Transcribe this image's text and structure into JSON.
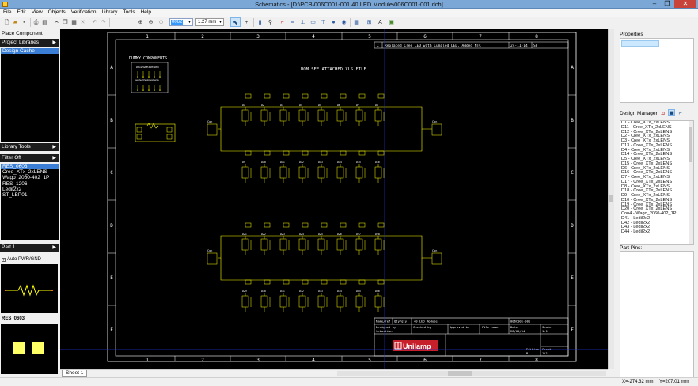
{
  "window": {
    "title": "Schematics - [D:\\PCB\\006C001-001 40 LED Module\\006C001-001.dch]",
    "min": "–",
    "max": "❐",
    "close": "✕"
  },
  "menu": [
    "File",
    "Edit",
    "View",
    "Objects",
    "Verification",
    "Library",
    "Tools",
    "Help"
  ],
  "toolbar": {
    "zoom_value": "0062",
    "grid_value": "1.27 mm"
  },
  "left_panel": {
    "place_component": "Place Component",
    "project_libraries": "Project Libraries",
    "design_cache": "Design Cache",
    "library_tools": "Library Tools",
    "filter": "Filter Off",
    "components": [
      "RES_0603",
      "Cree_XTx_2xLENS",
      "Wago_2060-402_1P",
      "RES_1206",
      "Ledil2x2",
      "ST_LBP01"
    ],
    "selected_component": "RES_0603",
    "part_selector": "Part 1",
    "auto_pwr_gnd": "Auto PWR/GND",
    "footprint_label": "RES_0603"
  },
  "sheet_tab": "Sheet 1",
  "schematic": {
    "col_labels": [
      "1",
      "2",
      "3",
      "4",
      "5",
      "6",
      "7",
      "8"
    ],
    "row_labels": [
      "A",
      "B",
      "C",
      "D",
      "E",
      "F"
    ],
    "dummy_title": "DUMMY COMPONENTS",
    "dummy_row1": "DH1DH2DH3DH4DH5",
    "dummy_row2": "DH6DH7DH8DH9DH10",
    "bom_note": "BOM SEE ATTACHED XLS FILE",
    "revision": {
      "rev": "C",
      "description": "Replaced Cree LED with Lumiled LED. Added NTC",
      "date": "24-11-14",
      "initials": "SF"
    },
    "title_block": {
      "name_label": "Name/ref",
      "qty_label": "Qty/qty",
      "module_name": "40 LED Module",
      "part_number": "006C001-001",
      "designed_by_label": "Designed by",
      "designed_by": "Sebastian",
      "checked_by_label": "Checked by",
      "approved_by_label": "Approved by",
      "file_name_label": "File name",
      "date_label": "Date",
      "date": "28/05/14",
      "scale_label": "Scale",
      "scale": "1:1",
      "edition_label": "Edition",
      "edition": "B",
      "sheet_label": "Sheet",
      "sheet": "1/1",
      "company": "Unilamp"
    },
    "top_string_top_leds": [
      "D1",
      "D2",
      "D3",
      "D4",
      "D5",
      "D6",
      "D7",
      "D8"
    ],
    "top_string_bottom_leds": [
      "D9",
      "D10",
      "D11",
      "D12",
      "D13",
      "D14",
      "D15",
      "D16"
    ],
    "bottom_string_top_leds": [
      "D21",
      "D22",
      "D23",
      "D24",
      "D25",
      "D26",
      "D27",
      "D28"
    ],
    "bottom_string_bottom_leds": [
      "D29",
      "D30",
      "D31",
      "D32",
      "D33",
      "D34",
      "D35",
      "D36"
    ],
    "connector_label": "Con"
  },
  "right_panel": {
    "properties_label": "Properties",
    "design_manager_label": "Design Manager",
    "design_manager_items": [
      "D1 - Cree_XTx_2xLENS",
      "D11 - Cree_XTx_2xLENS",
      "D12 - Cree_XTx_2xLENS",
      "D2 - Cree_XTx_2xLENS",
      "D3 - Cree_XTx_2xLENS",
      "D13 - Cree_XTx_2xLENS",
      "D4 - Cree_XTx_2xLENS",
      "D14 - Cree_XTx_2xLENS",
      "D5 - Cree_XTx_2xLENS",
      "D15 - Cree_XTx_2xLENS",
      "D6 - Cree_XTx_2xLENS",
      "D16 - Cree_XTx_2xLENS",
      "D7 - Cree_XTx_2xLENS",
      "D17 - Cree_XTx_2xLENS",
      "D8 - Cree_XTx_2xLENS",
      "D18 - Cree_XTx_2xLENS",
      "D9 - Cree_XTx_2xLENS",
      "D10 - Cree_XTx_2xLENS",
      "D19 - Cree_XTx_2xLENS",
      "D20 - Cree_XTx_2xLENS",
      "Con4 - Wago_2060-402_1P",
      "D41 - Ledil2x2",
      "D42 - Ledil2x2",
      "D43 - Ledil2x2",
      "D44 - Ledil2x2"
    ],
    "part_pins_label": "Part Pins:"
  },
  "status": {
    "x": "X=-274.32 mm",
    "y": "Y=207.01 mm"
  },
  "colors": {
    "canvas": "#000000",
    "wire": "#ffff00",
    "frame": "#ffffff",
    "cursor": "#2233cc",
    "highlight": "#3a7fd5",
    "brand_red": "#c8202b"
  }
}
